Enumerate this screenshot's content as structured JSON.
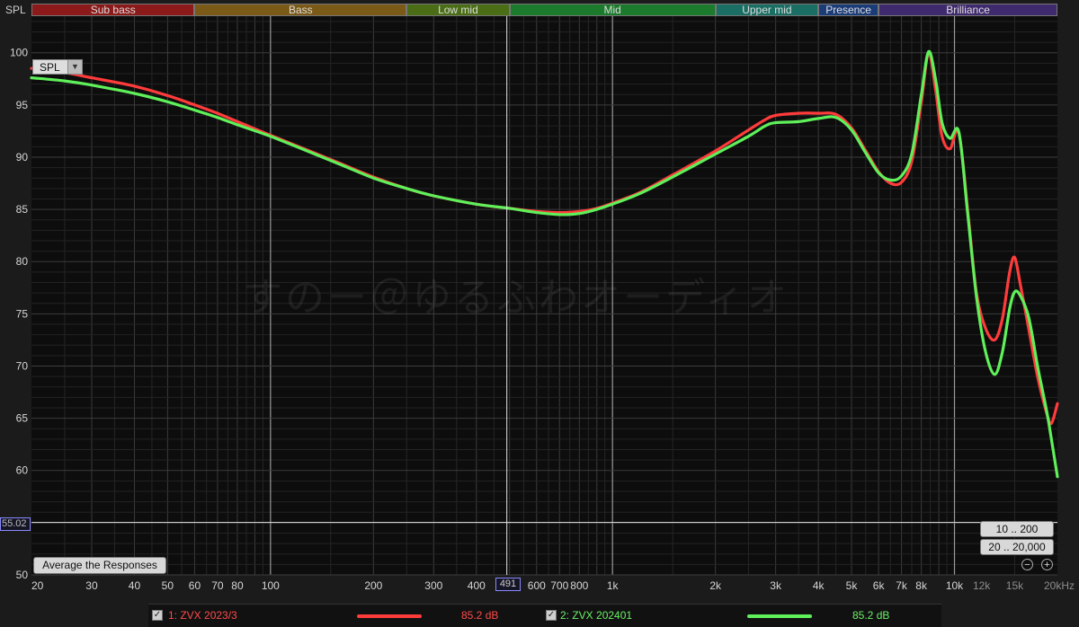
{
  "corner_label": "SPL",
  "bands": [
    {
      "label": "Sub bass",
      "from": 20,
      "to": 60,
      "color": "#8c1a1a"
    },
    {
      "label": "Bass",
      "from": 60,
      "to": 250,
      "color": "#7a5a16"
    },
    {
      "label": "Low mid",
      "from": 250,
      "to": 500,
      "color": "#4a6d16"
    },
    {
      "label": "Mid",
      "from": 500,
      "to": 2000,
      "color": "#1b7a2c"
    },
    {
      "label": "Upper mid",
      "from": 2000,
      "to": 4000,
      "color": "#1a6e64"
    },
    {
      "label": "Presence",
      "from": 4000,
      "to": 6000,
      "color": "#1c3c78"
    },
    {
      "label": "Brilliance",
      "from": 6000,
      "to": 20000,
      "color": "#3f2a6e"
    }
  ],
  "controls": {
    "spl_select": "SPL",
    "average_button": "Average the Responses",
    "range_buttons": [
      "10 .. 200",
      "20 .. 20,000"
    ],
    "cursor_y_value": "55.02",
    "cursor_x_value": "491"
  },
  "watermark": "すのー＠ゆるふわオーディオ",
  "chart_data": {
    "type": "line",
    "xscale": "log",
    "xlim": [
      20,
      20000
    ],
    "ylim": [
      50,
      103.5
    ],
    "grid": true,
    "x_ticks": [
      {
        "v": 20,
        "label": "20"
      },
      {
        "v": 30,
        "label": "30"
      },
      {
        "v": 40,
        "label": "40"
      },
      {
        "v": 50,
        "label": "50"
      },
      {
        "v": 60,
        "label": "60"
      },
      {
        "v": 70,
        "label": "70"
      },
      {
        "v": 80,
        "label": "80"
      },
      {
        "v": 100,
        "label": "100"
      },
      {
        "v": 200,
        "label": "200"
      },
      {
        "v": 300,
        "label": "300"
      },
      {
        "v": 400,
        "label": "400"
      },
      {
        "v": 600,
        "label": "600"
      },
      {
        "v": 700,
        "label": "700"
      },
      {
        "v": 800,
        "label": "800"
      },
      {
        "v": 1000,
        "label": "1k"
      },
      {
        "v": 2000,
        "label": "2k"
      },
      {
        "v": 3000,
        "label": "3k"
      },
      {
        "v": 4000,
        "label": "4k"
      },
      {
        "v": 5000,
        "label": "5k"
      },
      {
        "v": 6000,
        "label": "6k"
      },
      {
        "v": 7000,
        "label": "7k"
      },
      {
        "v": 8000,
        "label": "8k"
      },
      {
        "v": 10000,
        "label": "10k"
      },
      {
        "v": 12000,
        "label": "12k"
      },
      {
        "v": 15000,
        "label": "15k"
      },
      {
        "v": 20000,
        "label": "20kHz"
      }
    ],
    "y_ticks": [
      {
        "v": 50,
        "label": "50"
      },
      {
        "v": 60,
        "label": "60"
      },
      {
        "v": 65,
        "label": "65"
      },
      {
        "v": 70,
        "label": "70"
      },
      {
        "v": 75,
        "label": "75"
      },
      {
        "v": 80,
        "label": "80"
      },
      {
        "v": 85,
        "label": "85"
      },
      {
        "v": 90,
        "label": "90"
      },
      {
        "v": 95,
        "label": "95"
      },
      {
        "v": 100,
        "label": "100"
      }
    ],
    "cursor": {
      "x": 491,
      "y": 55.02
    },
    "series": [
      {
        "name": "1: ZVX 2023/3",
        "level": "85.2 dB",
        "color": "#ff3b3b",
        "points": [
          [
            20,
            98.5
          ],
          [
            25,
            98.1
          ],
          [
            30,
            97.6
          ],
          [
            40,
            96.8
          ],
          [
            50,
            95.9
          ],
          [
            60,
            95.0
          ],
          [
            70,
            94.2
          ],
          [
            80,
            93.4
          ],
          [
            100,
            92.1
          ],
          [
            130,
            90.6
          ],
          [
            160,
            89.4
          ],
          [
            200,
            88.1
          ],
          [
            250,
            87.0
          ],
          [
            300,
            86.3
          ],
          [
            400,
            85.5
          ],
          [
            500,
            85.1
          ],
          [
            600,
            84.8
          ],
          [
            700,
            84.7
          ],
          [
            800,
            84.8
          ],
          [
            900,
            85.1
          ],
          [
            1000,
            85.6
          ],
          [
            1200,
            86.6
          ],
          [
            1500,
            88.3
          ],
          [
            2000,
            90.6
          ],
          [
            2500,
            92.6
          ],
          [
            2800,
            93.6
          ],
          [
            3000,
            94.0
          ],
          [
            3500,
            94.2
          ],
          [
            4000,
            94.2
          ],
          [
            4500,
            94.1
          ],
          [
            5000,
            92.8
          ],
          [
            5500,
            90.6
          ],
          [
            6000,
            88.6
          ],
          [
            6500,
            87.5
          ],
          [
            7000,
            87.6
          ],
          [
            7500,
            89.6
          ],
          [
            8000,
            95.3
          ],
          [
            8400,
            100.0
          ],
          [
            8800,
            96.5
          ],
          [
            9200,
            92.0
          ],
          [
            9700,
            90.8
          ],
          [
            10300,
            92.3
          ],
          [
            11000,
            84.0
          ],
          [
            11600,
            77.0
          ],
          [
            12300,
            73.7
          ],
          [
            13100,
            72.5
          ],
          [
            13800,
            74.5
          ],
          [
            14500,
            79.0
          ],
          [
            15000,
            80.4
          ],
          [
            15600,
            77.7
          ],
          [
            16500,
            73.5
          ],
          [
            17500,
            69.0
          ],
          [
            18600,
            65.5
          ],
          [
            19200,
            64.5
          ],
          [
            20000,
            66.4
          ]
        ]
      },
      {
        "name": "2: ZVX 202401",
        "level": "85.2 dB",
        "color": "#5ff05a",
        "points": [
          [
            20,
            97.6
          ],
          [
            25,
            97.3
          ],
          [
            30,
            96.9
          ],
          [
            40,
            96.1
          ],
          [
            50,
            95.3
          ],
          [
            60,
            94.5
          ],
          [
            70,
            93.8
          ],
          [
            80,
            93.1
          ],
          [
            100,
            92.0
          ],
          [
            130,
            90.5
          ],
          [
            160,
            89.3
          ],
          [
            200,
            88.0
          ],
          [
            250,
            87.0
          ],
          [
            300,
            86.3
          ],
          [
            400,
            85.5
          ],
          [
            500,
            85.1
          ],
          [
            600,
            84.7
          ],
          [
            700,
            84.5
          ],
          [
            800,
            84.6
          ],
          [
            900,
            85.0
          ],
          [
            1000,
            85.5
          ],
          [
            1200,
            86.5
          ],
          [
            1500,
            88.1
          ],
          [
            2000,
            90.3
          ],
          [
            2500,
            92.0
          ],
          [
            2800,
            93.0
          ],
          [
            3000,
            93.3
          ],
          [
            3500,
            93.4
          ],
          [
            4000,
            93.7
          ],
          [
            4500,
            93.8
          ],
          [
            5000,
            92.6
          ],
          [
            5500,
            90.4
          ],
          [
            6000,
            88.5
          ],
          [
            6500,
            87.8
          ],
          [
            7000,
            88.2
          ],
          [
            7500,
            90.3
          ],
          [
            8000,
            96.0
          ],
          [
            8400,
            100.1
          ],
          [
            8800,
            97.5
          ],
          [
            9200,
            93.3
          ],
          [
            9700,
            91.8
          ],
          [
            10300,
            92.4
          ],
          [
            10900,
            85.0
          ],
          [
            11600,
            76.6
          ],
          [
            12300,
            71.5
          ],
          [
            13100,
            69.2
          ],
          [
            13800,
            71.3
          ],
          [
            14500,
            75.5
          ],
          [
            15000,
            77.1
          ],
          [
            15600,
            76.7
          ],
          [
            16500,
            74.6
          ],
          [
            17500,
            70.0
          ],
          [
            18600,
            65.7
          ],
          [
            19200,
            63.0
          ],
          [
            20000,
            59.4
          ]
        ]
      }
    ]
  }
}
